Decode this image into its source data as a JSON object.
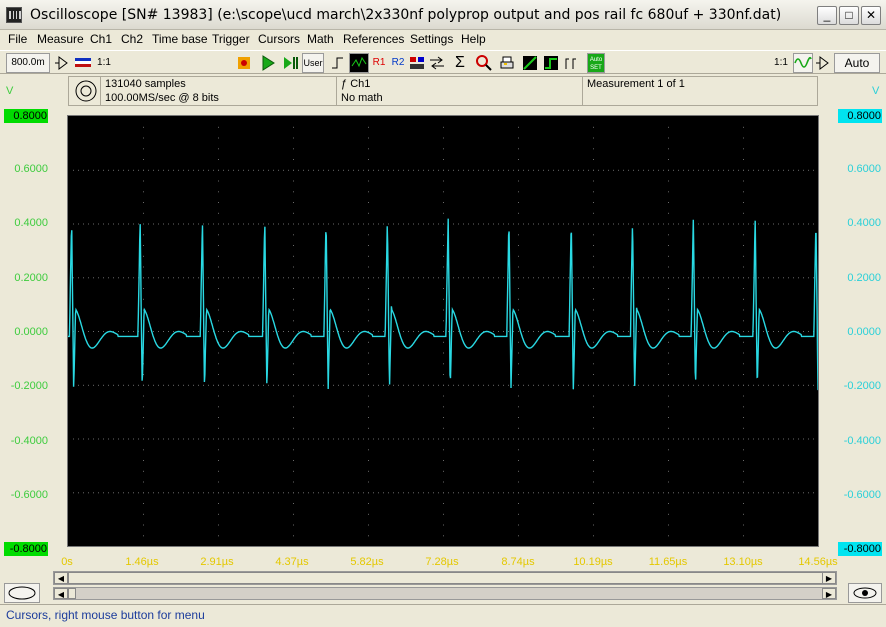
{
  "window": {
    "title": "Oscilloscope  [SN# 13983]  (e:\\scope\\ucd march\\2x330nf polyprop output and pos rail fc 680uf + 330nf.dat)",
    "minimize": "_",
    "maximize": "□",
    "close": "✕"
  },
  "menu": [
    "File",
    "Measure",
    "Ch1",
    "Ch2",
    "Time base",
    "Trigger",
    "Cursors",
    "Math",
    "References",
    "Settings",
    "Help"
  ],
  "toolbar": {
    "timebase_value": "800.0m",
    "zoom_label": "1:1",
    "user_label": "User",
    "r1_label": "R1",
    "r2_label": "R2",
    "autoset_label": "Auto SET",
    "right_zoom_label": "1:1",
    "auto_label": "Auto"
  },
  "info": {
    "samples": "131040 samples",
    "rate": "100.00MS/sec @ 8 bits",
    "channel": "Ch1",
    "math": "No math",
    "measurement": "Measurement 1 of 1"
  },
  "axes": {
    "unit": "V",
    "left_ticks": [
      "0.8000",
      "0.6000",
      "0.4000",
      "0.2000",
      "0.0000",
      "-0.2000",
      "-0.4000",
      "-0.6000",
      "-0.8000"
    ],
    "right_ticks": [
      "0.8000",
      "0.6000",
      "0.4000",
      "0.2000",
      "0.0000",
      "-0.2000",
      "-0.4000",
      "-0.6000",
      "-0.8000"
    ],
    "time_ticks": [
      "0s",
      "1.46µs",
      "2.91µs",
      "4.37µs",
      "5.82µs",
      "7.28µs",
      "8.74µs",
      "10.19µs",
      "11.65µs",
      "13.10µs",
      "14.56µs"
    ]
  },
  "colors": {
    "trace": "#29d9e3",
    "left_axis": "#3ecc3e",
    "right_axis": "#2ad0d8",
    "time_axis": "#e4c800",
    "grid_dot": "#6a6a6a"
  },
  "status": "Cursors, right mouse button for menu",
  "chart_data": {
    "type": "line",
    "xlabel": "",
    "ylabel": "V",
    "xlim": [
      0,
      14.56
    ],
    "ylim": [
      -0.8,
      0.8
    ],
    "x_unit": "µs",
    "grid": true,
    "spike_times": [
      0.07,
      1.4,
      2.61,
      3.82,
      5.01,
      6.2,
      7.38,
      8.56,
      9.77,
      10.96,
      12.14,
      13.34,
      14.52
    ],
    "series": [
      {
        "baseline": -0.02,
        "spike_peak": 0.42,
        "spike_trough": -0.22
      }
    ]
  }
}
